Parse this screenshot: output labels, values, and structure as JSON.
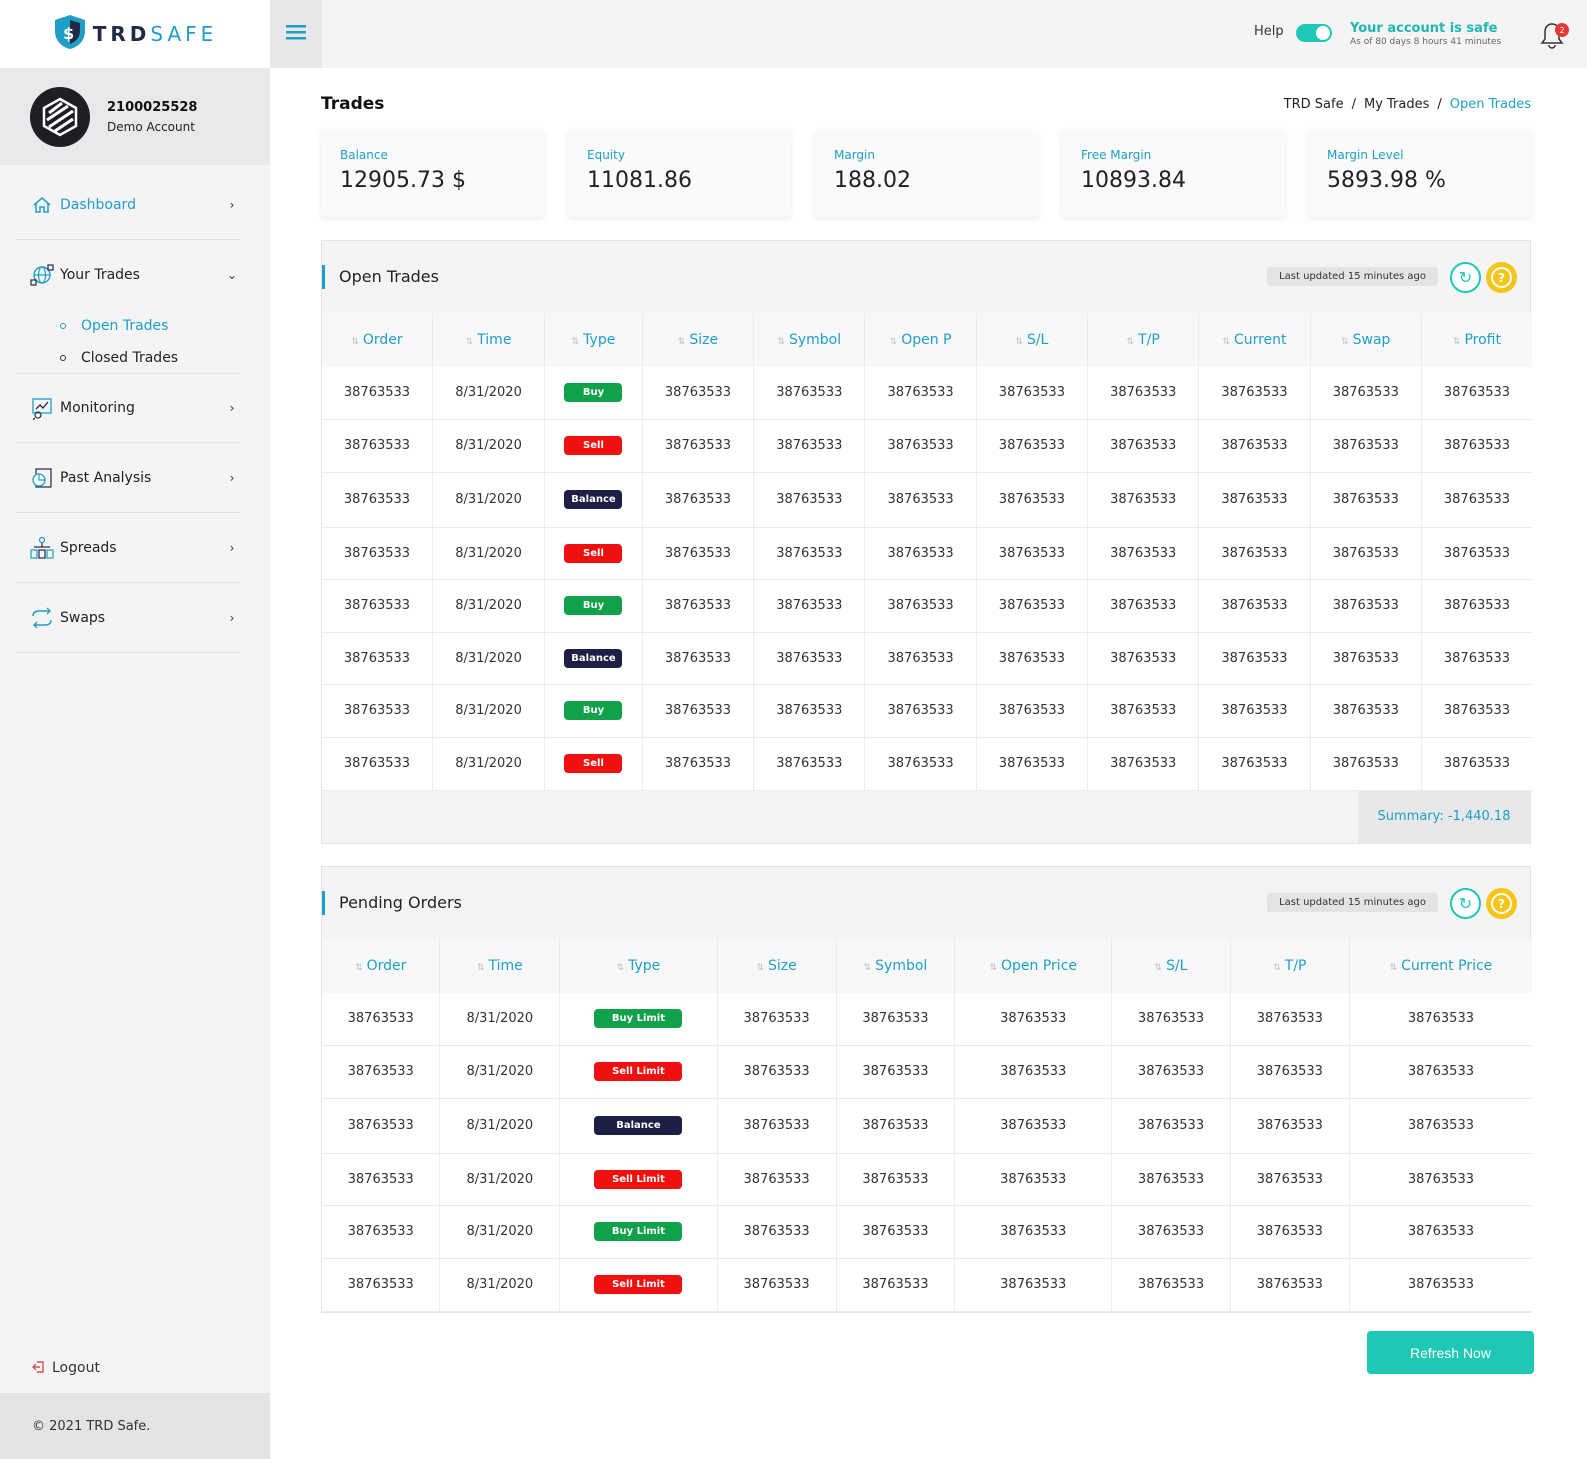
{
  "brand": {
    "logo_part1": "TRD",
    "logo_part2": "SAFE"
  },
  "account": {
    "number": "2100025528",
    "type": "Demo Account"
  },
  "sidebar": {
    "items": [
      {
        "label": "Dashboard",
        "icon": "home-icon"
      },
      {
        "label": "Your Trades",
        "icon": "globe-icon"
      },
      {
        "label": "Monitoring",
        "icon": "monitoring-icon"
      },
      {
        "label": "Past Analysis",
        "icon": "analysis-icon"
      },
      {
        "label": "Spreads",
        "icon": "spreads-icon"
      },
      {
        "label": "Swaps",
        "icon": "swaps-icon"
      }
    ],
    "subitems": [
      {
        "label": "Open Trades",
        "active": true
      },
      {
        "label": "Closed Trades",
        "active": false
      }
    ],
    "logout": "Logout",
    "footer": "© 2021 TRD Safe."
  },
  "topbar": {
    "help_label": "Help",
    "safe_title": "Your account is safe",
    "safe_subtitle": "As of 80 days 8 hours 41 minutes",
    "notification_count": "2"
  },
  "page": {
    "title": "Trades",
    "breadcrumb": [
      "TRD Safe",
      "My Trades",
      "Open Trades"
    ]
  },
  "stats": [
    {
      "label": "Balance",
      "value": "12905.73 $"
    },
    {
      "label": "Equity",
      "value": "11081.86"
    },
    {
      "label": "Margin",
      "value": "188.02"
    },
    {
      "label": "Free Margin",
      "value": "10893.84"
    },
    {
      "label": "Margin Level",
      "value": "5893.98 %"
    }
  ],
  "open_trades": {
    "title": "Open Trades",
    "updated": "Last updated 15 minutes ago",
    "columns": [
      "Order",
      "Time",
      "Type",
      "Size",
      "Symbol",
      "Open P",
      "S/L",
      "T/P",
      "Current",
      "Swap",
      "Profit"
    ],
    "rows": [
      [
        "38763533",
        "8/31/2020",
        "Buy",
        "38763533",
        "38763533",
        "38763533",
        "38763533",
        "38763533",
        "38763533",
        "38763533",
        "38763533"
      ],
      [
        "38763533",
        "8/31/2020",
        "Sell",
        "38763533",
        "38763533",
        "38763533",
        "38763533",
        "38763533",
        "38763533",
        "38763533",
        "38763533"
      ],
      [
        "38763533",
        "8/31/2020",
        "Balance",
        "38763533",
        "38763533",
        "38763533",
        "38763533",
        "38763533",
        "38763533",
        "38763533",
        "38763533"
      ],
      [
        "38763533",
        "8/31/2020",
        "Sell",
        "38763533",
        "38763533",
        "38763533",
        "38763533",
        "38763533",
        "38763533",
        "38763533",
        "38763533"
      ],
      [
        "38763533",
        "8/31/2020",
        "Buy",
        "38763533",
        "38763533",
        "38763533",
        "38763533",
        "38763533",
        "38763533",
        "38763533",
        "38763533"
      ],
      [
        "38763533",
        "8/31/2020",
        "Balance",
        "38763533",
        "38763533",
        "38763533",
        "38763533",
        "38763533",
        "38763533",
        "38763533",
        "38763533"
      ],
      [
        "38763533",
        "8/31/2020",
        "Buy",
        "38763533",
        "38763533",
        "38763533",
        "38763533",
        "38763533",
        "38763533",
        "38763533",
        "38763533"
      ],
      [
        "38763533",
        "8/31/2020",
        "Sell",
        "38763533",
        "38763533",
        "38763533",
        "38763533",
        "38763533",
        "38763533",
        "38763533",
        "38763533"
      ]
    ],
    "summary": "Summary: -1,440.18"
  },
  "pending_orders": {
    "title": "Pending Orders",
    "updated": "Last updated 15 minutes ago",
    "columns": [
      "Order",
      "Time",
      "Type",
      "Size",
      "Symbol",
      "Open Price",
      "S/L",
      "T/P",
      "Current Price"
    ],
    "rows": [
      [
        "38763533",
        "8/31/2020",
        "Buy Limit",
        "38763533",
        "38763533",
        "38763533",
        "38763533",
        "38763533",
        "38763533"
      ],
      [
        "38763533",
        "8/31/2020",
        "Sell Limit",
        "38763533",
        "38763533",
        "38763533",
        "38763533",
        "38763533",
        "38763533"
      ],
      [
        "38763533",
        "8/31/2020",
        "Balance",
        "38763533",
        "38763533",
        "38763533",
        "38763533",
        "38763533",
        "38763533"
      ],
      [
        "38763533",
        "8/31/2020",
        "Sell Limit",
        "38763533",
        "38763533",
        "38763533",
        "38763533",
        "38763533",
        "38763533"
      ],
      [
        "38763533",
        "8/31/2020",
        "Buy Limit",
        "38763533",
        "38763533",
        "38763533",
        "38763533",
        "38763533",
        "38763533"
      ],
      [
        "38763533",
        "8/31/2020",
        "Sell Limit",
        "38763533",
        "38763533",
        "38763533",
        "38763533",
        "38763533",
        "38763533"
      ]
    ]
  },
  "refresh_button": "Refresh Now",
  "colors": {
    "accent": "#1f9fc7",
    "teal": "#1fc8b4",
    "buy": "#12a14b",
    "sell": "#ef1010",
    "balance": "#1d1f44",
    "help": "#f5c518"
  }
}
